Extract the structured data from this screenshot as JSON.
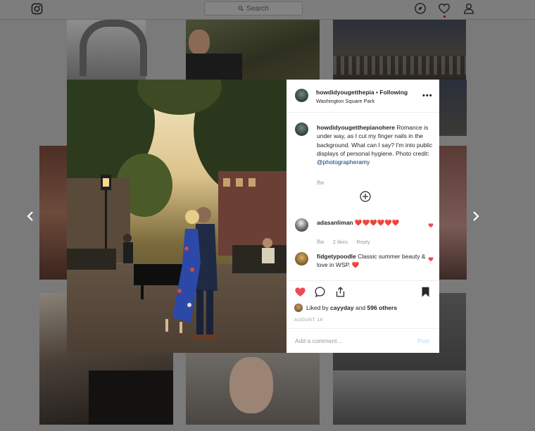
{
  "topbar": {
    "search_placeholder": "Search"
  },
  "post": {
    "username": "howdidyougetthepia",
    "separator": "•",
    "follow_label": "Following",
    "location": "Washington Square Park",
    "more_label": "•••",
    "caption": {
      "username": "howdidyougetthepianohere",
      "text": "Romance is under way, as I cut my finger nails in the background. What can I say? I'm into public displays of personal hygiene. Photo credit:",
      "mention": "@photographeramy",
      "time": "8w"
    },
    "comments": [
      {
        "username": "adasanliman",
        "text": "❤️❤️❤️❤️❤️❤️",
        "time": "8w",
        "likes": "2 likes",
        "reply": "Reply"
      },
      {
        "username": "fidgetypoodle",
        "text": "Classic summer beauty & love in WSP. ❤️"
      }
    ],
    "liked_by_prefix": "Liked by",
    "liked_by_user": "cayyday",
    "liked_by_and": "and",
    "liked_by_count": "596 others",
    "date": "AUGUST 14",
    "comment_placeholder": "Add a comment…",
    "post_button": "Post"
  },
  "colors": {
    "heart_red": "#ed4956",
    "link_blue": "#003569",
    "post_disabled": "#b8d6f3"
  },
  "icons": {
    "logo": "instagram-icon",
    "explore": "compass-icon",
    "activity": "heart-outline-icon",
    "profile": "person-icon",
    "load_more": "plus-circle-icon",
    "like": "heart-filled-icon",
    "comment": "speech-bubble-icon",
    "share": "share-icon",
    "save": "bookmark-filled-icon"
  }
}
